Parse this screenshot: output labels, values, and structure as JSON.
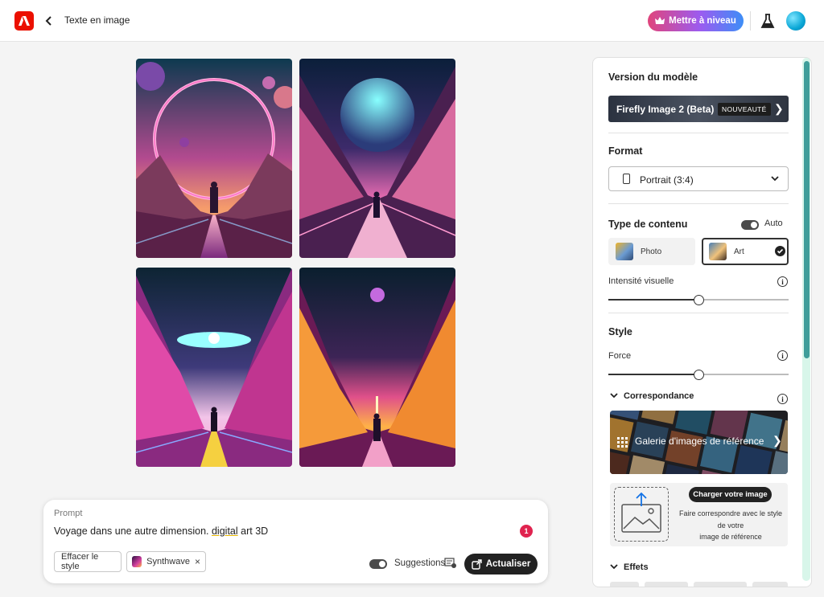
{
  "header": {
    "breadcrumb": "Texte en image",
    "upgrade_label": "Mettre à niveau",
    "accent": "#eb1000"
  },
  "prompt": {
    "label": "Prompt",
    "text_before": "Voyage dans une autre dimension. ",
    "text_underlined": "digital",
    "text_after": " art 3D",
    "badge_count": "1",
    "clear_style_label": "Effacer le style",
    "style_chip_label": "Synthwave",
    "suggestions_label": "Suggestions",
    "update_label": "Actualiser"
  },
  "panel": {
    "model_version_title": "Version du modèle",
    "model_name": "Firefly Image 2 (Beta)",
    "model_badge": "NOUVEAUTÉ",
    "format_title": "Format",
    "format_value": "Portrait (3:4)",
    "content_type_title": "Type de contenu",
    "auto_label": "Auto",
    "content_types": [
      "Photo",
      "Art"
    ],
    "selected_content_type": "Art",
    "visual_intensity_label": "Intensité visuelle",
    "visual_intensity_value": 0.5,
    "style_title": "Style",
    "strength_label": "Force",
    "strength_value": 0.5,
    "match_title": "Correspondance",
    "gallery_label": "Galerie d'images de référence",
    "upload_button": "Charger votre image",
    "upload_desc_1": "Faire correspondre avec le style",
    "upload_desc_2": "de votre",
    "upload_desc_3": "image de référence",
    "effects_title": "Effets"
  },
  "icons": {
    "logo": "adobe-logo-icon",
    "back": "chevron-left-icon",
    "crown": "crown-icon",
    "flask": "flask-icon",
    "info": "info-icon",
    "grid": "grid-icon"
  }
}
